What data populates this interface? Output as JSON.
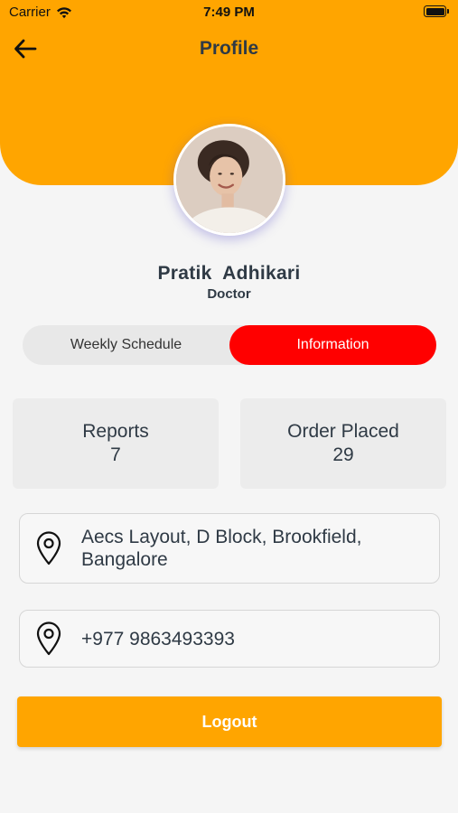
{
  "status_bar": {
    "carrier": "Carrier",
    "time": "7:49 PM",
    "wifi_icon": "wifi-icon",
    "battery_icon": "battery-full-icon"
  },
  "nav": {
    "back_icon": "arrow-left-icon",
    "title": "Profile"
  },
  "profile": {
    "name": "Pratik  Adhikari",
    "role": "Doctor"
  },
  "tabs": [
    {
      "label": "Weekly Schedule",
      "active": false
    },
    {
      "label": "Information",
      "active": true
    }
  ],
  "stats": {
    "reports": {
      "label": "Reports",
      "value": "7"
    },
    "orders": {
      "label": "Order Placed",
      "value": "29"
    }
  },
  "info": {
    "address": "Aecs Layout, D Block, Brookfield, Bangalore",
    "phone": "+977 9863493393",
    "icon": "location-pin-icon"
  },
  "logout_label": "Logout",
  "colors": {
    "header": "#ffa500",
    "active_tab": "#ff0000",
    "button": "#ffa500",
    "background": "#f5f5f5"
  }
}
